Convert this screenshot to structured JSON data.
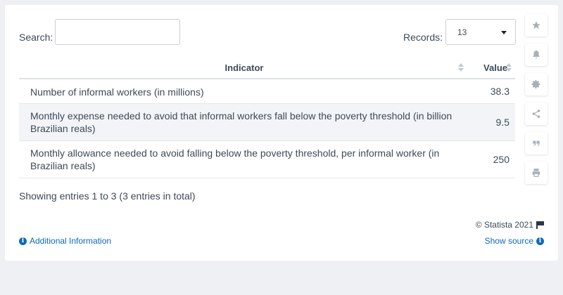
{
  "controls": {
    "search_label": "Search:",
    "search_value": "",
    "records_label": "Records:",
    "records_value": "13"
  },
  "table": {
    "headers": [
      "Indicator",
      "Value"
    ],
    "rows": [
      {
        "indicator": "Number of informal workers (in millions)",
        "value": "38.3"
      },
      {
        "indicator": "Monthly expense needed to avoid that informal workers fall below the poverty threshold (in billion Brazilian reals)",
        "value": "9.5"
      },
      {
        "indicator": "Monthly allowance needed to avoid falling below the poverty threshold, per informal worker (in Brazilian reals)",
        "value": "250"
      }
    ]
  },
  "footer": {
    "showing": "Showing entries 1 to 3 (3 entries in total)",
    "copyright": "© Statista 2021",
    "additional_info": "Additional Information",
    "show_source": "Show source"
  },
  "sidebar_icons": [
    "star-icon",
    "bell-icon",
    "gear-icon",
    "share-icon",
    "quote-icon",
    "print-icon"
  ],
  "colors": {
    "link": "#0d6aba",
    "text": "#3d4a57",
    "stripe": "#f2f4f7",
    "background": "#eef0f3"
  }
}
